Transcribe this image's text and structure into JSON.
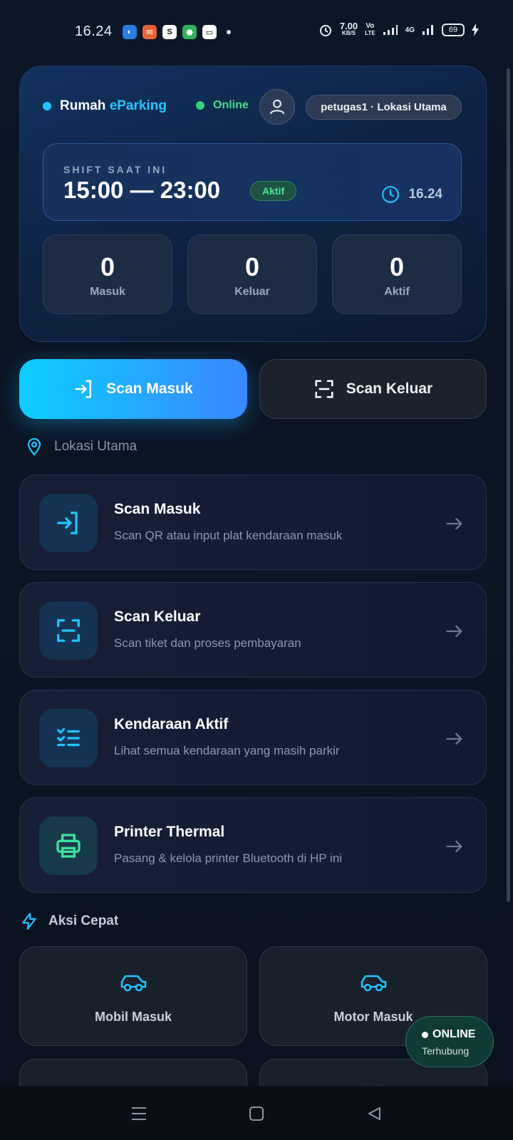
{
  "status_bar": {
    "time": "16.24",
    "net_speed": "7.00",
    "net_unit": "KB/S",
    "volte": "Vo",
    "volte2": "LTE",
    "network": "4G",
    "battery": "69"
  },
  "header": {
    "brand_prefix": "Rumah",
    "brand_name": "eParking",
    "connection_status": "Online",
    "user_chip": "petugas1 · Lokasi Utama"
  },
  "shift": {
    "label": "SHIFT SAAT INI",
    "time_range": "15:00 — 23:00",
    "badge": "Aktif",
    "clock": "16.24"
  },
  "stats": [
    {
      "value": "0",
      "label": "Masuk"
    },
    {
      "value": "0",
      "label": "Keluar"
    },
    {
      "value": "0",
      "label": "Aktif"
    }
  ],
  "actions": {
    "scan_in": "Scan Masuk",
    "scan_out": "Scan Keluar"
  },
  "location": "Lokasi Utama",
  "menu": [
    {
      "title": "Scan Masuk",
      "subtitle": "Scan QR atau input plat kendaraan masuk",
      "icon": "login-icon"
    },
    {
      "title": "Scan Keluar",
      "subtitle": "Scan tiket dan proses pembayaran",
      "icon": "scan-icon"
    },
    {
      "title": "Kendaraan Aktif",
      "subtitle": "Lihat semua kendaraan yang masih parkir",
      "icon": "checklist-icon"
    },
    {
      "title": "Printer Thermal",
      "subtitle": "Pasang & kelola printer Bluetooth di HP ini",
      "icon": "printer-icon"
    }
  ],
  "quick_actions": {
    "title": "Aksi Cepat",
    "items": [
      {
        "label": "Mobil Masuk",
        "icon": "car-icon"
      },
      {
        "label": "Motor Masuk",
        "icon": "car-icon"
      }
    ]
  },
  "toast": {
    "title": "ONLINE",
    "subtitle": "Terhubung"
  },
  "colors": {
    "accent": "#1ec8ff",
    "accent_gradient_end": "#3a86ff",
    "online": "#36d07a",
    "background": "#0a1220"
  }
}
